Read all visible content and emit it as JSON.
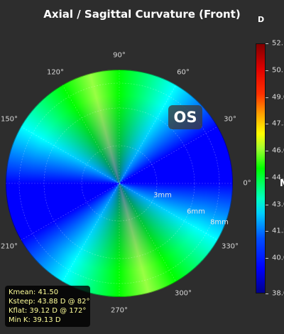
{
  "title": "Axial / Sagittal Curvature (Front)",
  "colorbar": {
    "unit": "D",
    "ticks": [
      "52.",
      "50.",
      "49.0",
      "47.5",
      "46.0",
      "44.5",
      "43.0",
      "41.5",
      "40.0",
      "38.0"
    ],
    "marker": "M"
  },
  "polar": {
    "angle_labels": [
      "90°",
      "60°",
      "30°",
      "0°",
      "330°",
      "300°",
      "270°",
      "210°",
      "150°",
      "120°"
    ],
    "ring_labels": [
      "3mm",
      "6mm",
      "8mm"
    ],
    "eye": "OS"
  },
  "stats": {
    "lines": [
      "Kmean: 41.50",
      "Ksteep: 43.88 D @ 82°",
      "Kflat:  39.12 D @ 172°",
      "Min K: 39.13 D"
    ]
  }
}
